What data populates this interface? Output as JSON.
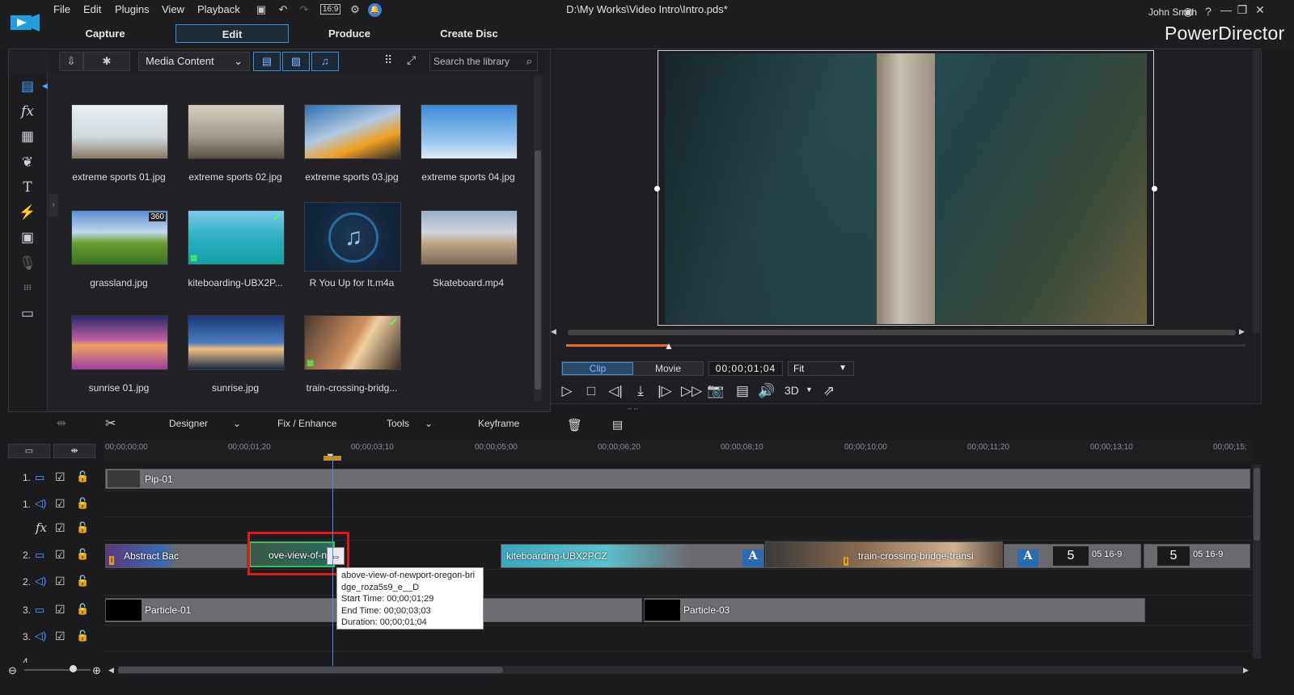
{
  "app": {
    "name": "PowerDirector",
    "document_title": "D:\\My Works\\Video Intro\\Intro.pds*",
    "user": "John Smith"
  },
  "menu": [
    "File",
    "Edit",
    "Plugins",
    "View",
    "Playback"
  ],
  "quick_toolbar": {
    "aspect_ratio": "16:9"
  },
  "mode_tabs": [
    {
      "label": "Capture",
      "active": false
    },
    {
      "label": "Edit",
      "active": true
    },
    {
      "label": "Produce",
      "active": false
    },
    {
      "label": "Create Disc",
      "active": false
    }
  ],
  "library": {
    "content_select": "Media Content",
    "search_placeholder": "Search the library",
    "items": [
      {
        "label": "extreme sports 01.jpg",
        "checked": false,
        "badge": ""
      },
      {
        "label": "extreme sports 02.jpg",
        "checked": false,
        "badge": ""
      },
      {
        "label": "extreme sports 03.jpg",
        "checked": false,
        "badge": ""
      },
      {
        "label": "extreme sports 04.jpg",
        "checked": false,
        "badge": ""
      },
      {
        "label": "grassland.jpg",
        "checked": false,
        "badge": "360"
      },
      {
        "label": "kiteboarding-UBX2P...",
        "checked": true,
        "badge": ""
      },
      {
        "label": "R You Up for It.m4a",
        "checked": false,
        "badge": ""
      },
      {
        "label": "Skateboard.mp4",
        "checked": false,
        "badge": ""
      },
      {
        "label": "sunrise 01.jpg",
        "checked": false,
        "badge": ""
      },
      {
        "label": "sunrise.jpg",
        "checked": false,
        "badge": ""
      },
      {
        "label": "train-crossing-bridg...",
        "checked": true,
        "badge": ""
      }
    ]
  },
  "preview": {
    "mode_clip": "Clip",
    "mode_movie": "Movie",
    "timecode": "00;00;01;04",
    "zoom": "Fit",
    "threed": "3D",
    "progress_fraction": 0.15
  },
  "edit_toolbar": {
    "designer": "Designer",
    "fix_enhance": "Fix / Enhance",
    "tools": "Tools",
    "keyframe": "Keyframe"
  },
  "timeline": {
    "ruler": [
      "00;00;00;00",
      "00;00;01;20",
      "00;00;03;10",
      "00;00;05;00",
      "00;00;06;20",
      "00;00;08;10",
      "00;00;10;00",
      "00;00;11;20",
      "00;00;13;10",
      "00;00;15;"
    ],
    "tracks": [
      {
        "num": "1.",
        "kind": "video"
      },
      {
        "num": "1.",
        "kind": "audio"
      },
      {
        "num": "",
        "kind": "fx"
      },
      {
        "num": "2.",
        "kind": "video"
      },
      {
        "num": "2.",
        "kind": "audio"
      },
      {
        "num": "3.",
        "kind": "video"
      },
      {
        "num": "3.",
        "kind": "audio"
      },
      {
        "num": "4.",
        "kind": "video"
      }
    ],
    "clips": {
      "pip": "Pip-01",
      "abstract": "Abstract Bac",
      "aerial": "ove-view-of-ne",
      "kite": "kiteboarding-UBX2PCZ",
      "train": "train-crossing-bridge-transi",
      "countdown1_num": "5",
      "countdown1_lbl": "05 16-9",
      "countdown2_num": "5",
      "countdown2_lbl": "05 16-9",
      "particle1": "Particle-01",
      "particle3": "Particle-03",
      "title_a": "A"
    },
    "tooltip": {
      "name": "above-view-of-newport-oregon-bridge_roza5s9_e__D",
      "start": "Start Time: 00;00;01;29",
      "end": "End Time: 00;00;03;03",
      "duration": "Duration: 00;00;01;04"
    }
  },
  "colors": {
    "accent": "#3f8fd0",
    "highlight": "#e01818",
    "progress": "#e0702a"
  }
}
